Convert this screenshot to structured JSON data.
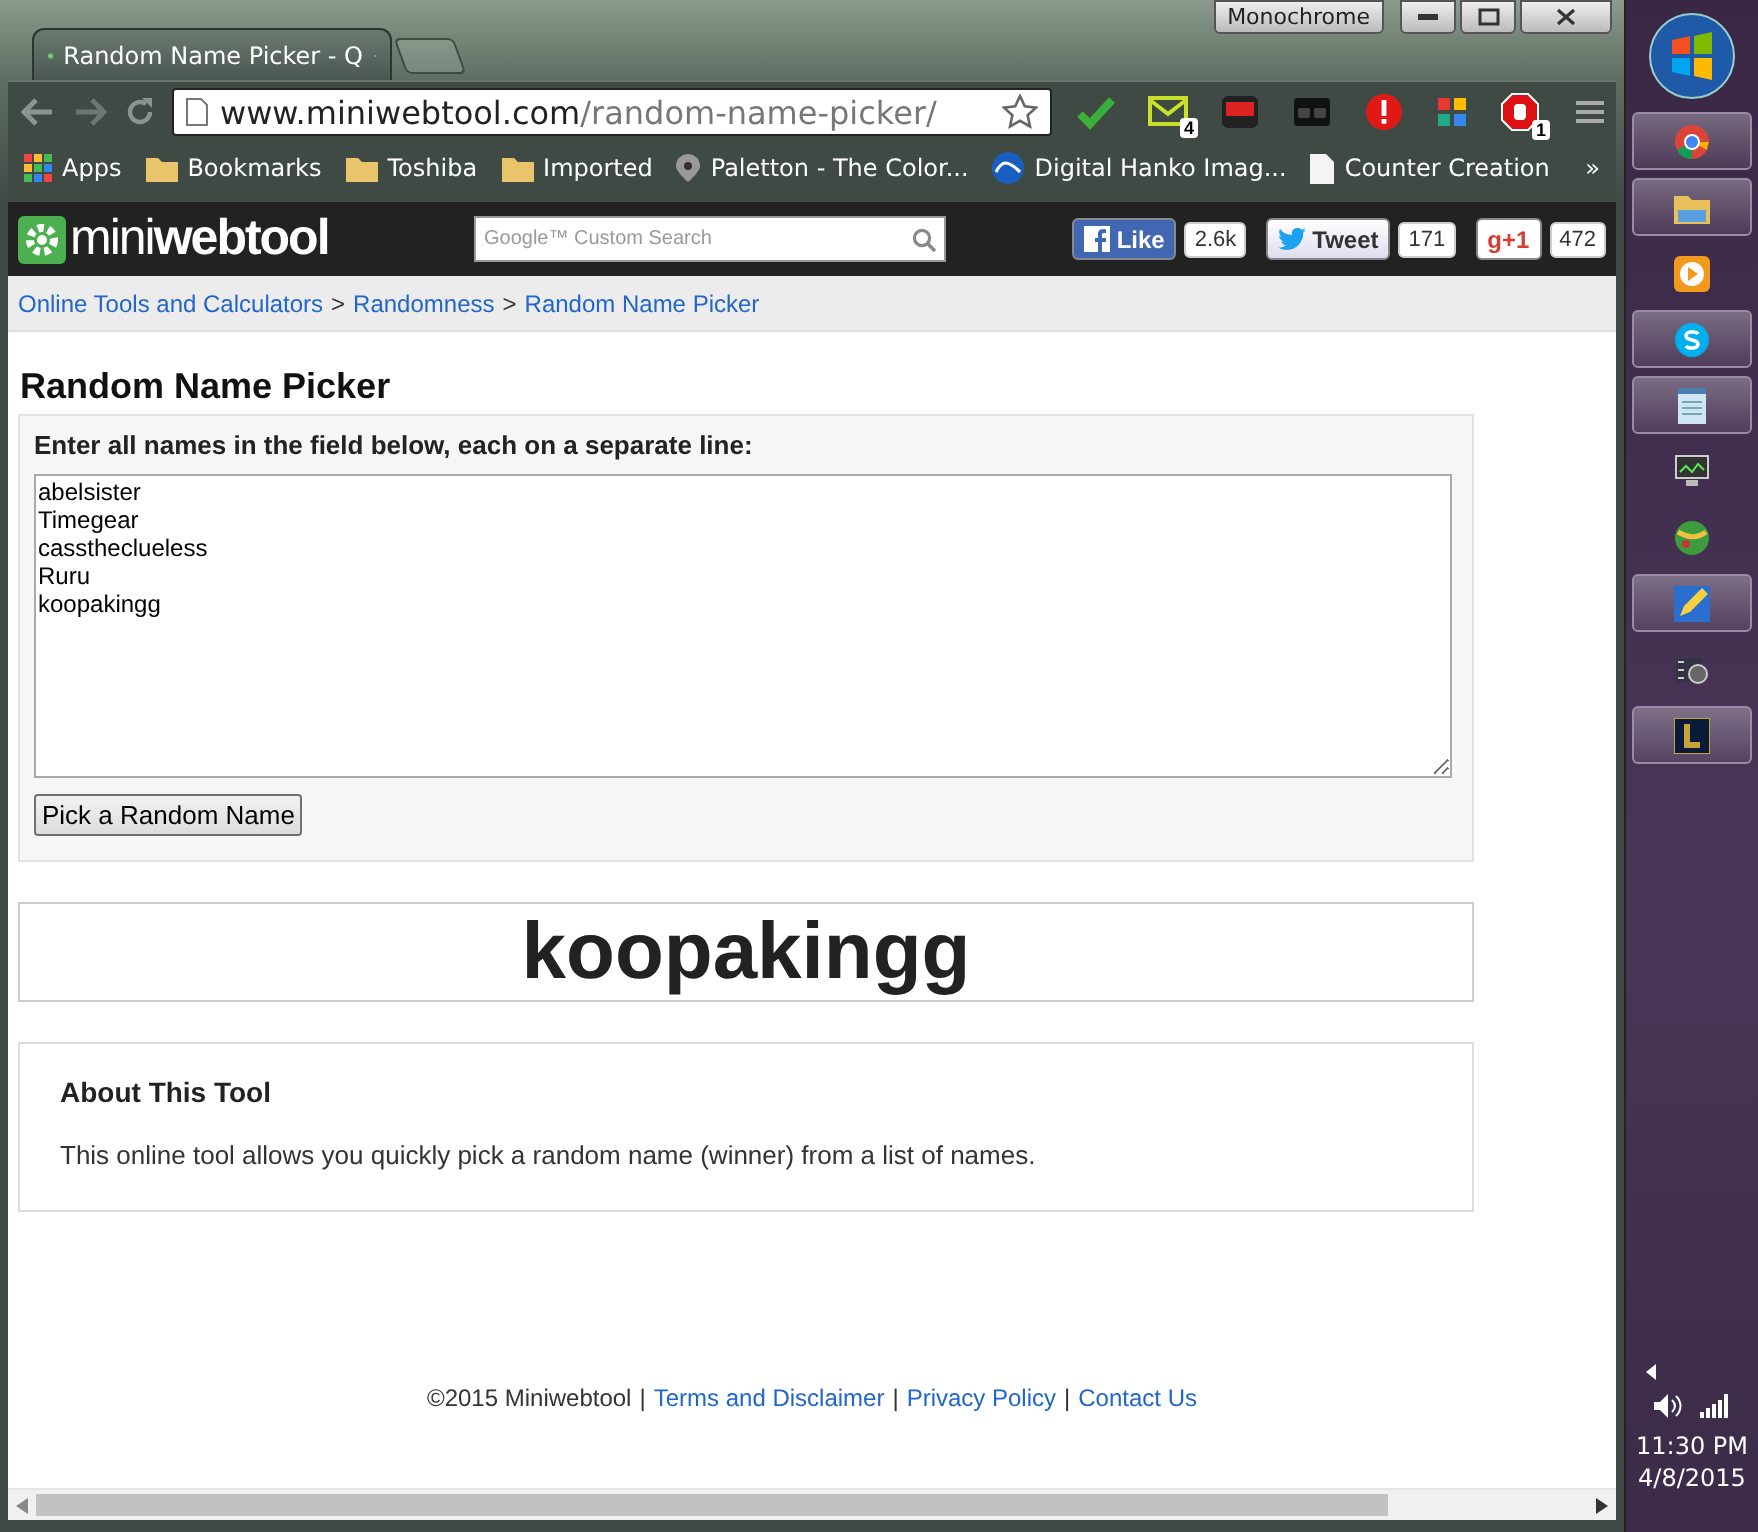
{
  "window": {
    "theme_label": "Monochrome",
    "tab": {
      "title": "Random Name Picker - Q"
    }
  },
  "toolbar": {
    "address": {
      "host": "www.miniwebtool.com",
      "path": "/random-name-picker/"
    },
    "extensions": [
      {
        "kind": "spell"
      },
      {
        "kind": "mail",
        "badge": "4"
      },
      {
        "kind": "video"
      },
      {
        "kind": "glasses"
      },
      {
        "kind": "alert"
      },
      {
        "kind": "tiles"
      },
      {
        "kind": "stop",
        "badge": "1"
      }
    ]
  },
  "bookmarks": {
    "items": [
      {
        "kind": "apps",
        "label": "Apps"
      },
      {
        "kind": "folder",
        "label": "Bookmarks"
      },
      {
        "kind": "folder",
        "label": "Toshiba"
      },
      {
        "kind": "folder",
        "label": "Imported"
      },
      {
        "kind": "site",
        "label": "Paletton - The Color..."
      },
      {
        "kind": "wave",
        "label": "Digital Hanko Imag..."
      },
      {
        "kind": "page",
        "label": "Counter Creation"
      }
    ],
    "more": "»"
  },
  "site_header": {
    "logo": "mini**webtool**",
    "search": {
      "placeholder": "Google™ Custom Search"
    },
    "social": [
      {
        "kind": "facebook",
        "label": "Like",
        "count": "2.6k"
      },
      {
        "kind": "twitter",
        "label": "Tweet",
        "count": "171"
      },
      {
        "kind": "gplus",
        "label": "g+1",
        "count": "472"
      }
    ]
  },
  "breadcrumbs": {
    "separator": ">",
    "items": [
      "Online Tools and Calculators",
      "Randomness",
      "Random Name Picker"
    ]
  },
  "tool": {
    "title": "Random Name Picker",
    "prompt": "Enter all names in the field below, each on a separate line:",
    "names": [
      "abelsister",
      "Timegear",
      "casstheclueless",
      "Ruru",
      "koopakingg"
    ],
    "button": "Pick a Random Name",
    "result": "koopakingg"
  },
  "about": {
    "title": "About This Tool",
    "text": "This online tool allows you quickly pick a random name (winner) from a list of names."
  },
  "footer": {
    "copyright": "©2015 Miniwebtool",
    "separator": "|",
    "links": [
      "Terms and Disclaimer",
      "Privacy Policy",
      "Contact Us"
    ]
  },
  "taskbar": {
    "items": [
      {
        "kind": "browser",
        "running": true
      },
      {
        "kind": "explorer",
        "running": true
      },
      {
        "kind": "player",
        "running": false
      },
      {
        "kind": "chat",
        "running": true
      },
      {
        "kind": "notepad",
        "running": true
      },
      {
        "kind": "monitor",
        "running": false
      },
      {
        "kind": "ball",
        "running": false
      },
      {
        "kind": "pencil",
        "running": true
      },
      {
        "kind": "film",
        "running": false
      },
      {
        "kind": "game",
        "running": true
      }
    ],
    "clock": {
      "time": "11:30 PM",
      "date": "4/8/2015"
    }
  }
}
